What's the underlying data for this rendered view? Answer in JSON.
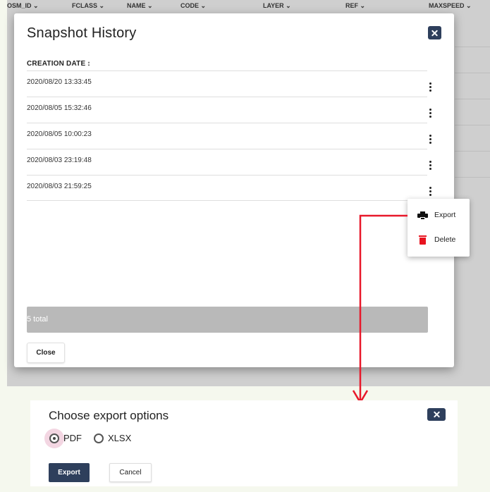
{
  "background_table": {
    "columns": [
      "OSM_ID ⌄",
      "FCLASS ⌄",
      "NAME ⌄",
      "CODE ⌄",
      "LAYER ⌄",
      "REF ⌄",
      "MAXSPEED ⌄"
    ]
  },
  "snapshot_history": {
    "title": "Snapshot History",
    "column_header": "CREATION DATE",
    "sort_indicator": "↕",
    "rows": [
      {
        "date": "2020/08/20 13:33:45"
      },
      {
        "date": "2020/08/05 15:32:46"
      },
      {
        "date": "2020/08/05 10:00:23"
      },
      {
        "date": "2020/08/03 23:19:48"
      },
      {
        "date": "2020/08/03 21:59:25"
      }
    ],
    "total_label": "5 total",
    "close_label": "Close"
  },
  "context_menu": {
    "items": [
      {
        "label": "Export",
        "icon": "printer-icon"
      },
      {
        "label": "Delete",
        "icon": "trash-icon"
      }
    ]
  },
  "export_options": {
    "title": "Choose export options",
    "formats": [
      {
        "label": "PDF",
        "selected": true
      },
      {
        "label": "XLSX",
        "selected": false
      }
    ],
    "export_label": "Export",
    "cancel_label": "Cancel"
  },
  "colors": {
    "primary": "#2e3f5c",
    "danger": "#e8131f",
    "arrow": "#e8182a"
  }
}
